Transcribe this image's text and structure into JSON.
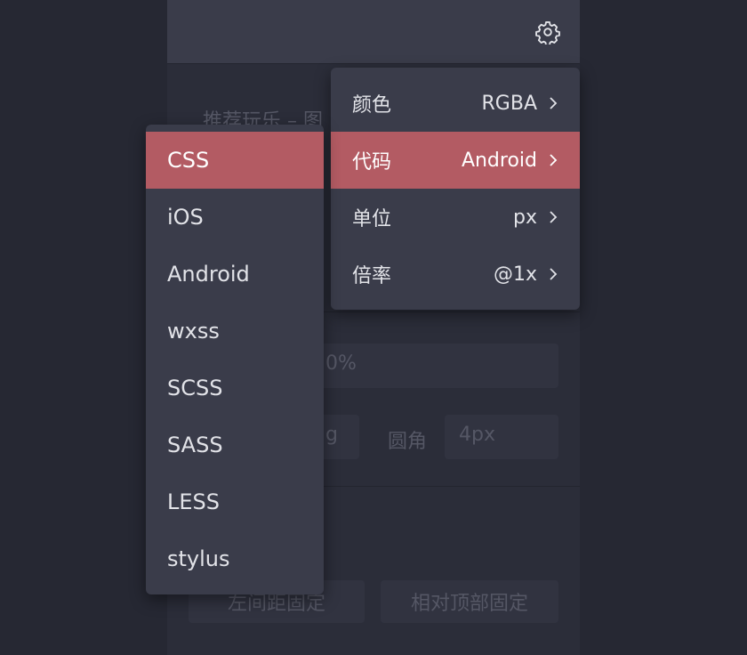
{
  "background": {
    "layer_title": "推荐玩乐 – 图",
    "opacity_value": "0%",
    "fill_value": "g",
    "radius_label": "圆角",
    "radius_value": "4px",
    "position_left": "左间距固定",
    "position_top": "相对顶部固定"
  },
  "toolbar": {
    "settings_icon": "gear-icon"
  },
  "settings_menu": {
    "items": [
      {
        "label": "颜色",
        "value": "RGBA"
      },
      {
        "label": "代码",
        "value": "Android"
      },
      {
        "label": "单位",
        "value": "px"
      },
      {
        "label": "倍率",
        "value": "@1x"
      }
    ],
    "active_index": 1
  },
  "code_menu": {
    "items": [
      "CSS",
      "iOS",
      "Android",
      "wxss",
      "SCSS",
      "SASS",
      "LESS",
      "stylus"
    ],
    "highlighted_index": 0
  },
  "colors": {
    "highlight": "#b35b63",
    "menu_bg": "#3a3c4a",
    "page_bg": "#262833"
  }
}
